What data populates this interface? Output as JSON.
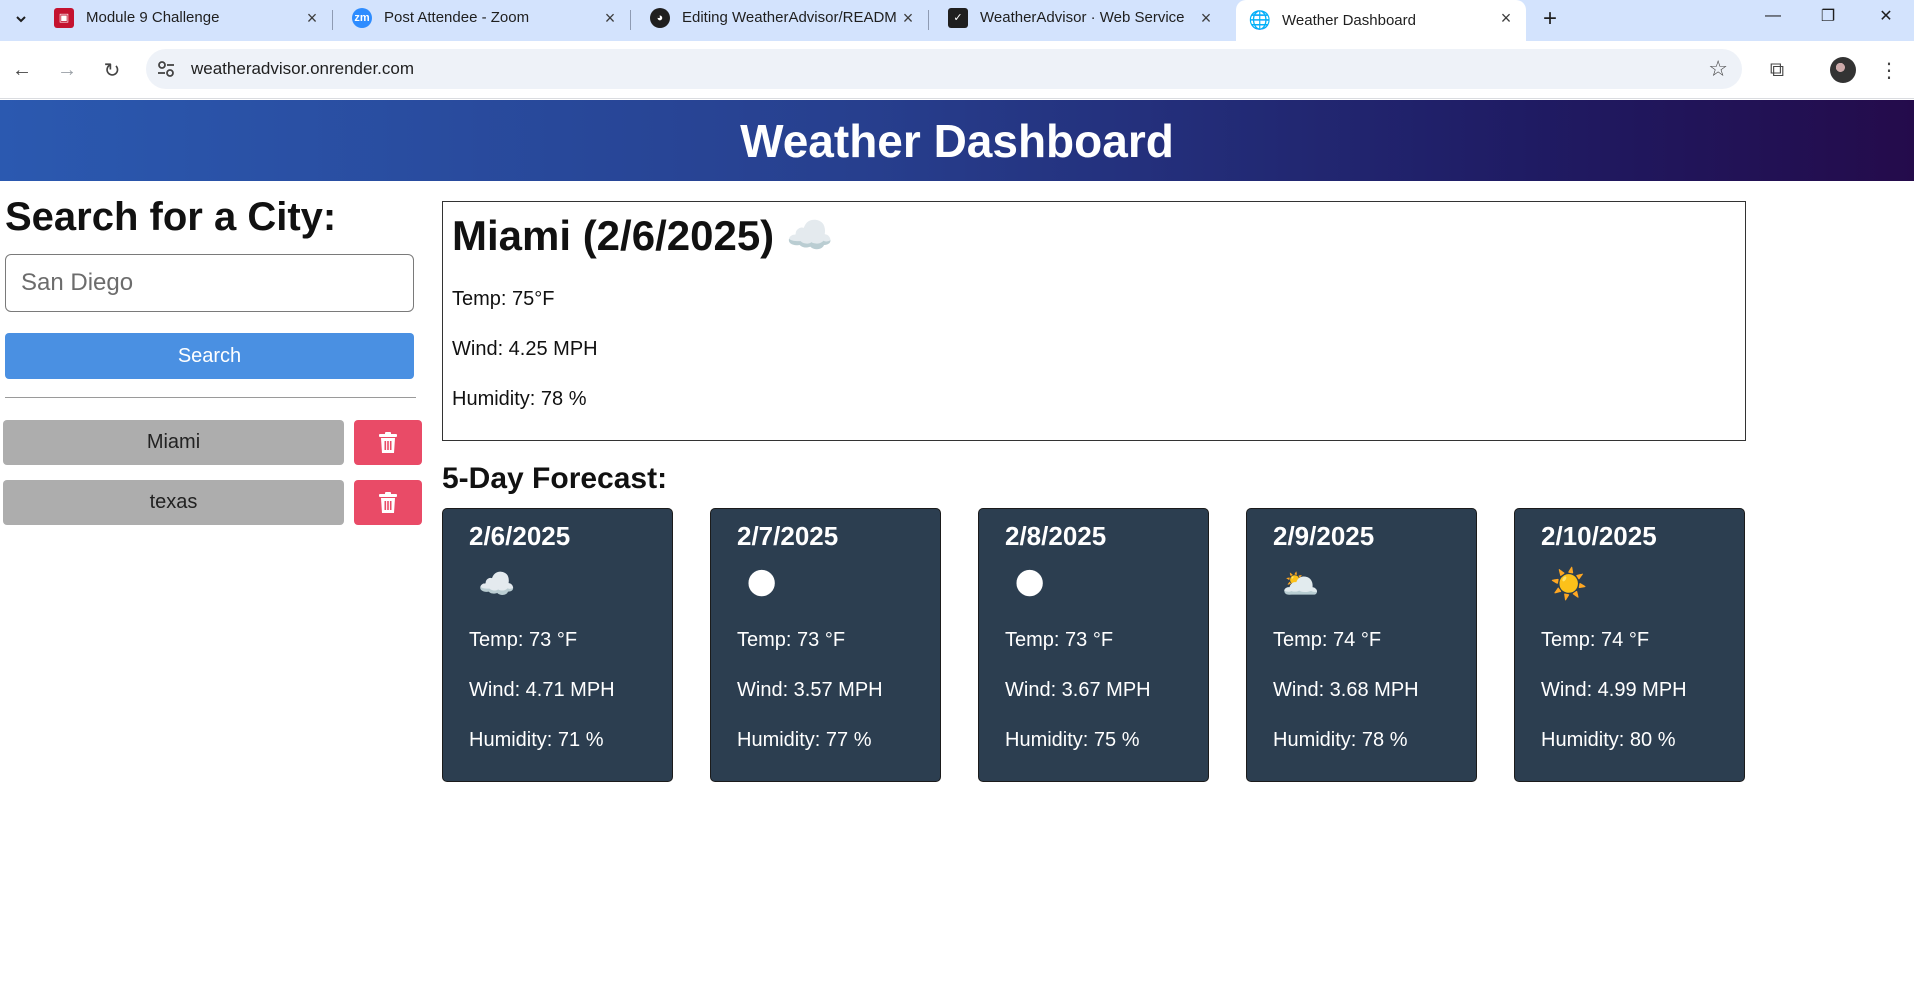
{
  "browser": {
    "tabs": [
      {
        "title": "Module 9 Challenge",
        "icon": "canvas-icon",
        "active": false
      },
      {
        "title": "Post Attendee - Zoom",
        "icon": "zoom-icon",
        "active": false
      },
      {
        "title": "Editing WeatherAdvisor/READM",
        "icon": "github-icon",
        "active": false
      },
      {
        "title": "WeatherAdvisor · Web Service",
        "icon": "render-icon",
        "active": false
      },
      {
        "title": "Weather Dashboard",
        "icon": "globe-icon",
        "active": true
      }
    ],
    "url": "weatheradvisor.onrender.com"
  },
  "header": {
    "title": "Weather Dashboard"
  },
  "sidebar": {
    "heading": "Search for a City:",
    "input_placeholder": "San Diego",
    "search_label": "Search",
    "history": [
      {
        "city": "Miami"
      },
      {
        "city": "texas"
      }
    ]
  },
  "today": {
    "title": "Miami (2/6/2025)",
    "icon": "☁️",
    "temp": "Temp: 75°F",
    "wind": "Wind: 4.25 MPH",
    "humidity": "Humidity: 78 %"
  },
  "forecast": {
    "heading": "5-Day Forecast:",
    "days": [
      {
        "date": "2/6/2025",
        "icon": "☁️",
        "temp": "Temp: 73 °F",
        "wind": "Wind: 4.71 MPH",
        "humidity": "Humidity: 71 %"
      },
      {
        "date": "2/7/2025",
        "icon": "🌑",
        "temp": "Temp: 73 °F",
        "wind": "Wind: 3.57 MPH",
        "humidity": "Humidity: 77 %"
      },
      {
        "date": "2/8/2025",
        "icon": "🌑",
        "temp": "Temp: 73 °F",
        "wind": "Wind: 3.67 MPH",
        "humidity": "Humidity: 75 %"
      },
      {
        "date": "2/9/2025",
        "icon": "🌥️",
        "temp": "Temp: 74 °F",
        "wind": "Wind: 3.68 MPH",
        "humidity": "Humidity: 78 %"
      },
      {
        "date": "2/10/2025",
        "icon": "☀️",
        "temp": "Temp: 74 °F",
        "wind": "Wind: 4.99 MPH",
        "humidity": "Humidity: 80 %"
      }
    ]
  },
  "colors": {
    "header_start": "#2b59b0",
    "header_end": "#240b4b",
    "search_button": "#4a90e2",
    "history_button": "#adadad",
    "delete_button": "#e94b67",
    "card_bg": "#2c3e50"
  }
}
